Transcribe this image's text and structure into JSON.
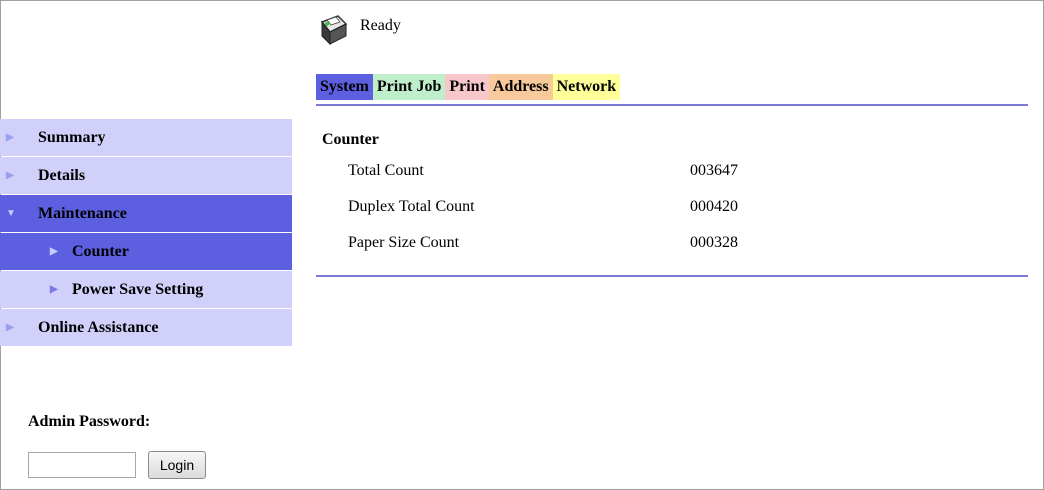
{
  "status": {
    "text": "Ready",
    "icon": "printer-icon"
  },
  "tabs": [
    {
      "label": "System"
    },
    {
      "label": "Print Job"
    },
    {
      "label": "Print"
    },
    {
      "label": "Address"
    },
    {
      "label": "Network"
    }
  ],
  "sidebar": {
    "items": [
      {
        "label": "Summary"
      },
      {
        "label": "Details"
      },
      {
        "label": "Maintenance"
      },
      {
        "label": "Counter"
      },
      {
        "label": "Power Save Setting"
      },
      {
        "label": "Online Assistance"
      }
    ]
  },
  "main": {
    "title": "Counter",
    "rows": [
      {
        "name": "Total Count",
        "value": "003647"
      },
      {
        "name": "Duplex Total Count",
        "value": "000420"
      },
      {
        "name": "Paper Size Count",
        "value": "000328"
      }
    ]
  },
  "admin": {
    "label": "Admin Password:",
    "password_value": "",
    "login_label": "Login"
  },
  "colors": {
    "active": "#5c5fe0",
    "nav_bg": "#d0d0fa",
    "tab_print_job": "#bfeecb",
    "tab_print": "#f7c7cc",
    "tab_address": "#f8c99a",
    "tab_network": "#ffff99",
    "rule": "#7a7ad6"
  }
}
